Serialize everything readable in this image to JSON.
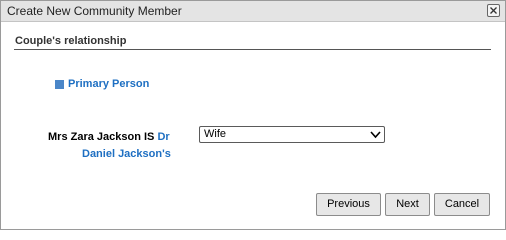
{
  "dialog": {
    "title": "Create New Community Member"
  },
  "section": {
    "title": "Couple's relationship"
  },
  "primary_person": {
    "label": "Primary Person"
  },
  "relationship": {
    "person": "Mrs Zara Jackson IS",
    "partner_part1": "Dr",
    "partner_part2": "Daniel Jackson's",
    "selected": "Wife"
  },
  "buttons": {
    "previous": "Previous",
    "next": "Next",
    "cancel": "Cancel"
  },
  "icons": {
    "close": "close-icon",
    "dropdown": "chevron-down-icon",
    "primary_marker": "square-icon"
  },
  "colors": {
    "link": "#1e6fc2",
    "marker": "#4a86c8"
  }
}
